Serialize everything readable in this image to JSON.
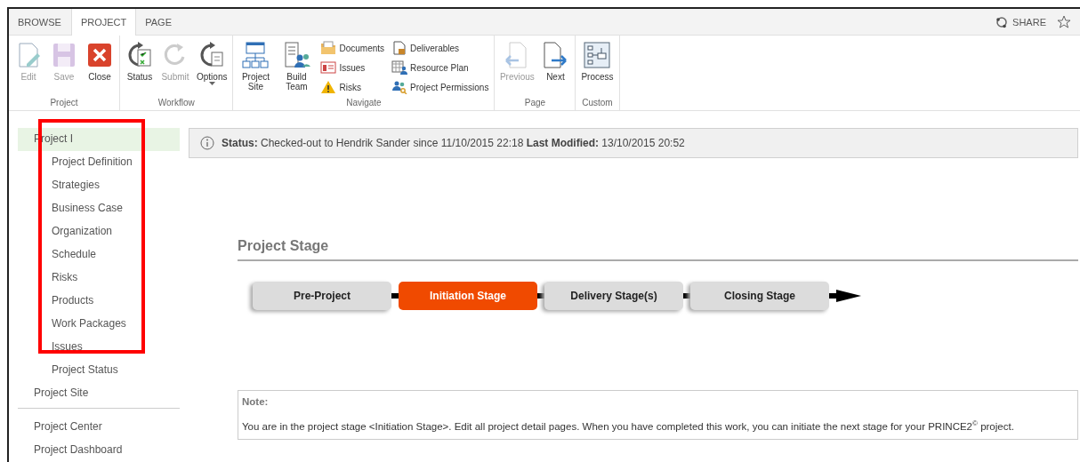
{
  "tabs": [
    {
      "label": "BROWSE",
      "selected": false
    },
    {
      "label": "PROJECT",
      "selected": true
    },
    {
      "label": "PAGE",
      "selected": false
    }
  ],
  "share": {
    "label": "SHARE"
  },
  "ribbon": [
    {
      "group": "Project",
      "items": [
        {
          "kind": "large",
          "label": "Edit",
          "disabled": true
        },
        {
          "kind": "large",
          "label": "Save",
          "disabled": true
        },
        {
          "kind": "large",
          "label": "Close",
          "disabled": false
        }
      ]
    },
    {
      "group": "Workflow",
      "items": [
        {
          "kind": "large",
          "label": "Status",
          "disabled": false
        },
        {
          "kind": "large",
          "label": "Submit",
          "disabled": true
        },
        {
          "kind": "dropdown",
          "label": "Options",
          "disabled": false
        }
      ]
    },
    {
      "group": "Navigate",
      "items": [
        {
          "kind": "large",
          "label": "Project Site",
          "disabled": false
        },
        {
          "kind": "large",
          "label": "Build Team",
          "disabled": false
        },
        {
          "kind": "small",
          "label": "Documents",
          "disabled": false
        },
        {
          "kind": "small",
          "label": "Issues",
          "disabled": false
        },
        {
          "kind": "small",
          "label": "Risks",
          "disabled": false
        },
        {
          "kind": "small",
          "label": "Deliverables",
          "disabled": false
        },
        {
          "kind": "small",
          "label": "Resource Plan",
          "disabled": false
        },
        {
          "kind": "small",
          "label": "Project Permissions",
          "disabled": false
        }
      ]
    },
    {
      "group": "Page",
      "items": [
        {
          "kind": "large",
          "label": "Previous",
          "disabled": true
        },
        {
          "kind": "large",
          "label": "Next",
          "disabled": false
        }
      ]
    },
    {
      "group": "Custom",
      "items": [
        {
          "kind": "large",
          "label": "Process",
          "disabled": false
        }
      ]
    }
  ],
  "sidebar": {
    "highlight_frame": true,
    "items": [
      {
        "label": "Project I",
        "selected": true,
        "children": [
          {
            "label": "Project Definition"
          },
          {
            "label": "Strategies"
          },
          {
            "label": "Business Case"
          },
          {
            "label": "Organization"
          },
          {
            "label": "Schedule"
          },
          {
            "label": "Risks"
          },
          {
            "label": "Products"
          },
          {
            "label": "Work Packages"
          },
          {
            "label": "Issues"
          },
          {
            "label": "Project Status"
          }
        ]
      },
      {
        "label": "Project Site",
        "selected": false
      }
    ],
    "footer_items": [
      {
        "label": "Project Center"
      },
      {
        "label": "Project Dashboard"
      }
    ]
  },
  "status": {
    "text": "**Status:** Checked-out to Hendrik Sander since 11/10/2015 22:18 **Last Modified:** 13/10/2015 20:52"
  },
  "stage_section": {
    "title": "Project Stage",
    "stages": [
      {
        "label": "Pre-Project",
        "selected": false
      },
      {
        "label": "Initiation Stage",
        "selected": true
      },
      {
        "label": "Delivery Stage(s)",
        "selected": false
      },
      {
        "label": "Closing Stage",
        "selected": false
      }
    ]
  },
  "note": {
    "title": "Note:",
    "text": "You are in the project stage <Initiation Stage>. Edit all project detail pages. When you have completed this work, you can initiate the next stage for your PRINCE2$^{©}$ project."
  }
}
